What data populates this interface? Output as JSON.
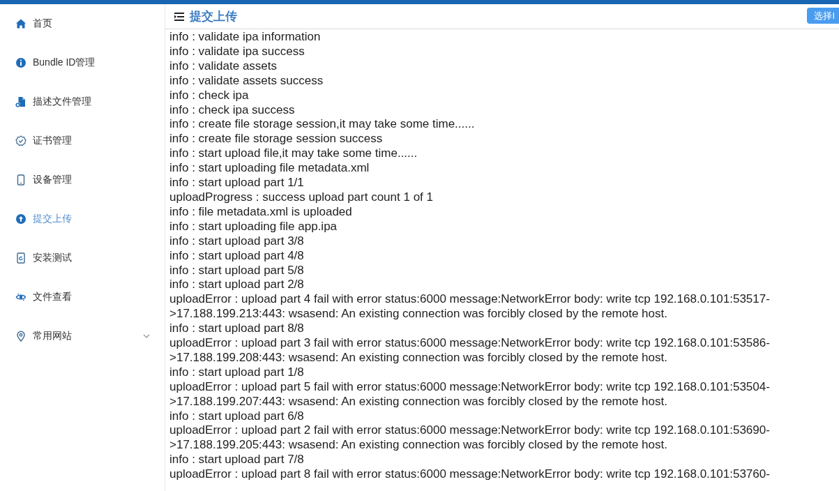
{
  "sidebar": {
    "items": [
      {
        "label": "首页",
        "selected": false
      },
      {
        "label": "Bundle ID管理",
        "selected": false
      },
      {
        "label": "描述文件管理",
        "selected": false
      },
      {
        "label": "证书管理",
        "selected": false
      },
      {
        "label": "设备管理",
        "selected": false
      },
      {
        "label": "提交上传",
        "selected": true
      },
      {
        "label": "安装测试",
        "selected": false
      },
      {
        "label": "文件查看",
        "selected": false
      },
      {
        "label": "常用网站",
        "selected": false,
        "expanded": false
      }
    ]
  },
  "header": {
    "title": "提交上传",
    "button": "选择I"
  },
  "log": [
    {
      "lines": [
        "info : validate ipa information"
      ]
    },
    {
      "lines": [
        "info : validate ipa success"
      ]
    },
    {
      "lines": [
        "info : validate assets"
      ]
    },
    {
      "lines": [
        "info : validate assets success"
      ]
    },
    {
      "lines": [
        "info : check ipa"
      ]
    },
    {
      "lines": [
        "info : check ipa success"
      ]
    },
    {
      "lines": [
        "info : create file storage session,it may take some time......"
      ]
    },
    {
      "lines": [
        "info : create file storage session success"
      ]
    },
    {
      "lines": [
        "info : start upload file,it may take some time......"
      ]
    },
    {
      "lines": [
        "info : start uploading file metadata.xml"
      ]
    },
    {
      "lines": [
        "info : start upload part 1/1"
      ]
    },
    {
      "lines": [
        "uploadProgress : success upload part count 1 of 1"
      ]
    },
    {
      "lines": [
        "info : file metadata.xml is uploaded"
      ]
    },
    {
      "lines": [
        "info : start uploading file app.ipa"
      ]
    },
    {
      "lines": [
        "info : start upload part 3/8"
      ]
    },
    {
      "lines": [
        "info : start upload part 4/8"
      ]
    },
    {
      "lines": [
        "info : start upload part 5/8"
      ]
    },
    {
      "lines": [
        "info : start upload part 2/8"
      ]
    },
    {
      "lines": [
        "uploadError : upload part 4 fail with error status:6000 message:NetworkError body: write tcp 192.168.0.101:53517-",
        ">17.188.199.213:443: wsasend: An existing connection was forcibly closed by the remote host."
      ]
    },
    {
      "lines": [
        "info : start upload part 8/8"
      ]
    },
    {
      "lines": [
        "uploadError : upload part 3 fail with error status:6000 message:NetworkError body: write tcp 192.168.0.101:53586-",
        ">17.188.199.208:443: wsasend: An existing connection was forcibly closed by the remote host."
      ]
    },
    {
      "lines": [
        "info : start upload part 1/8"
      ]
    },
    {
      "lines": [
        "uploadError : upload part 5 fail with error status:6000 message:NetworkError body: write tcp 192.168.0.101:53504-",
        ">17.188.199.207:443: wsasend: An existing connection was forcibly closed by the remote host."
      ]
    },
    {
      "lines": [
        "info : start upload part 6/8"
      ]
    },
    {
      "lines": [
        "uploadError : upload part 2 fail with error status:6000 message:NetworkError body: write tcp 192.168.0.101:53690-",
        ">17.188.199.205:443: wsasend: An existing connection was forcibly closed by the remote host."
      ]
    },
    {
      "lines": [
        "info : start upload part 7/8"
      ]
    },
    {
      "lines": [
        "uploadError : upload part 8 fail with error status:6000 message:NetworkError body: write tcp 192.168.0.101:53760-"
      ]
    }
  ]
}
